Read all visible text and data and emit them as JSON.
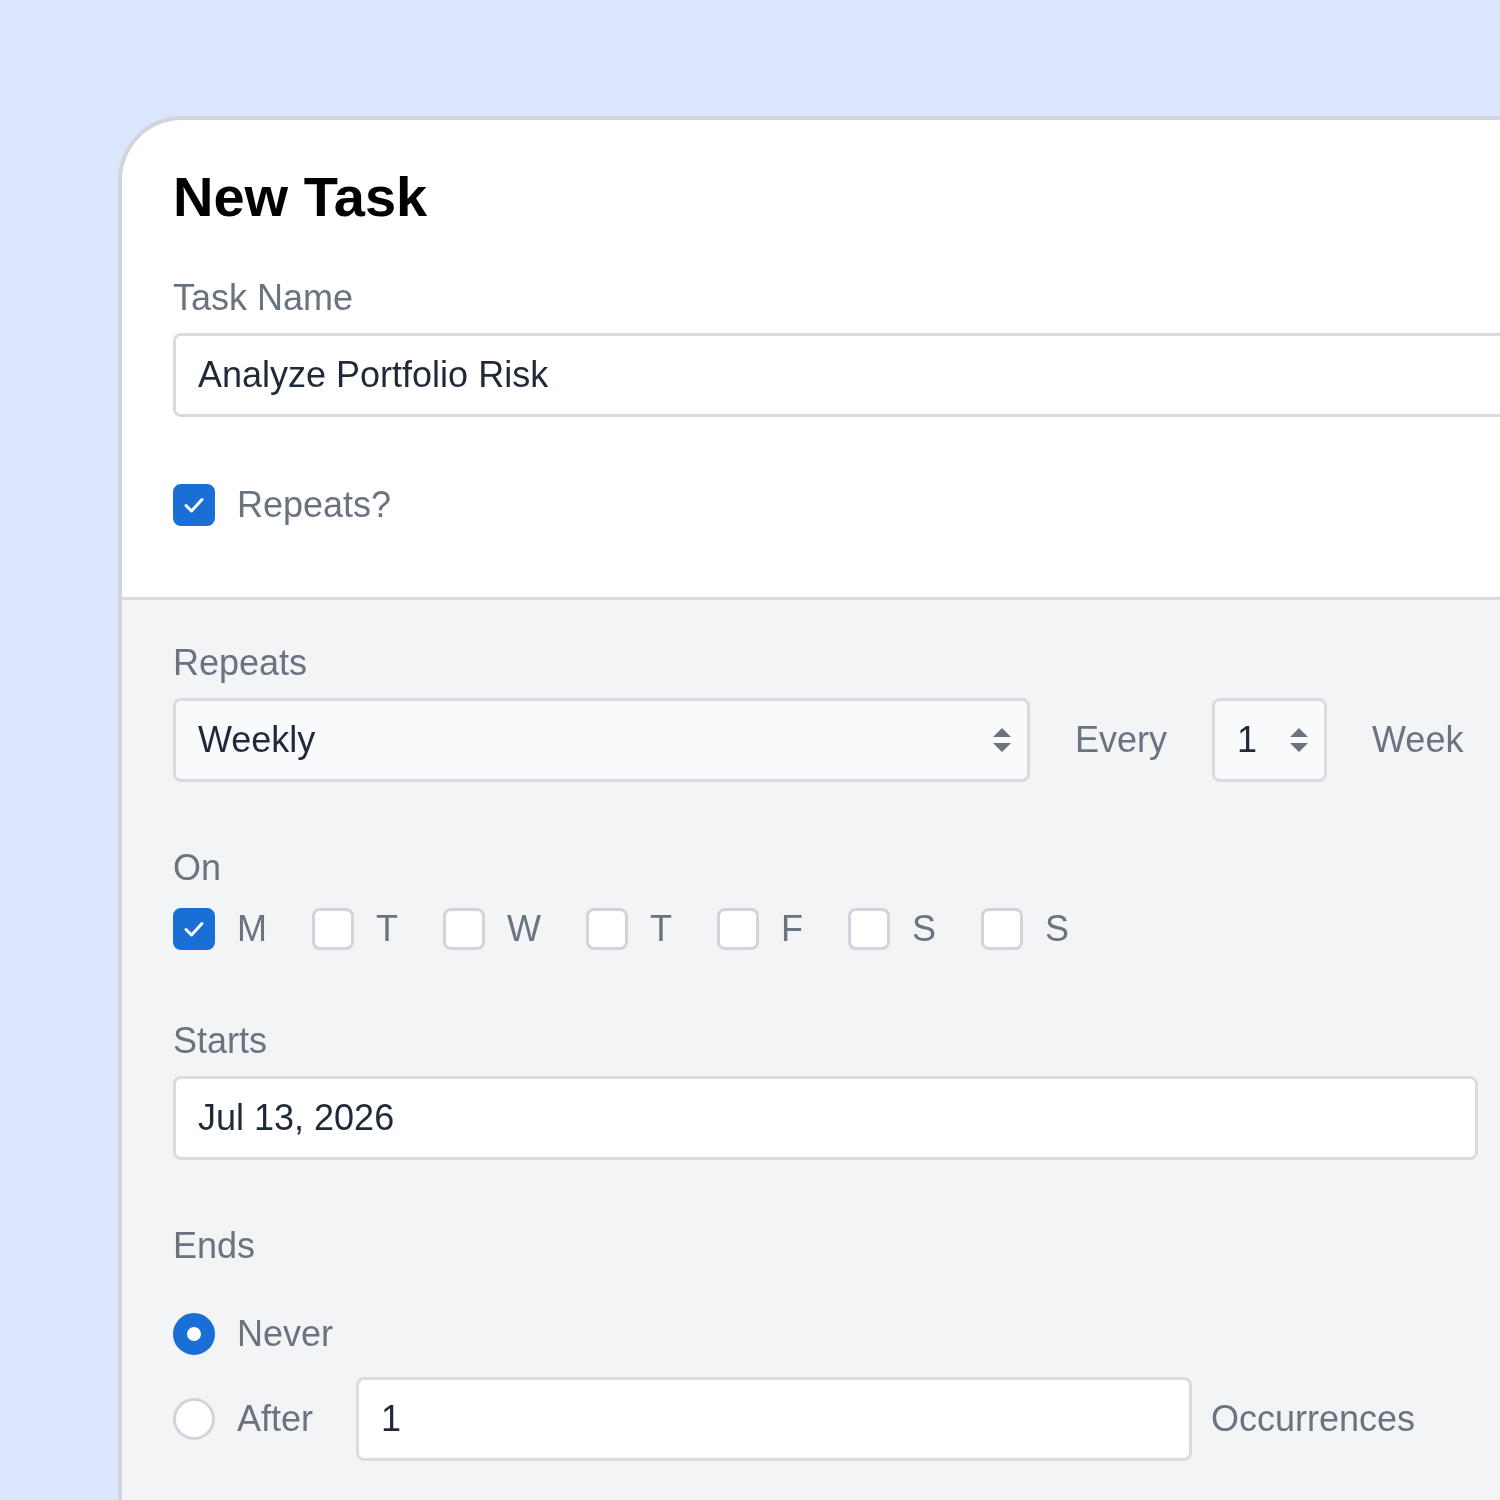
{
  "form": {
    "title": "New Task",
    "task_name": {
      "label": "Task Name",
      "value": "Analyze Portfolio Risk"
    },
    "repeats_toggle": {
      "label": "Repeats?",
      "checked": true
    }
  },
  "recurrence": {
    "repeats": {
      "label": "Repeats",
      "value": "Weekly"
    },
    "every_label": "Every",
    "interval": "1",
    "unit": "Week",
    "on_label": "On",
    "days": [
      {
        "label": "M",
        "checked": true
      },
      {
        "label": "T",
        "checked": false
      },
      {
        "label": "W",
        "checked": false
      },
      {
        "label": "T",
        "checked": false
      },
      {
        "label": "F",
        "checked": false
      },
      {
        "label": "S",
        "checked": false
      },
      {
        "label": "S",
        "checked": false
      }
    ],
    "starts": {
      "label": "Starts",
      "value": "Jul 13, 2026"
    },
    "ends": {
      "label": "Ends",
      "options": [
        {
          "kind": "never",
          "label": "Never",
          "selected": true
        },
        {
          "kind": "after",
          "label": "After",
          "selected": false,
          "count": "1",
          "suffix": "Occurrences"
        }
      ]
    }
  }
}
